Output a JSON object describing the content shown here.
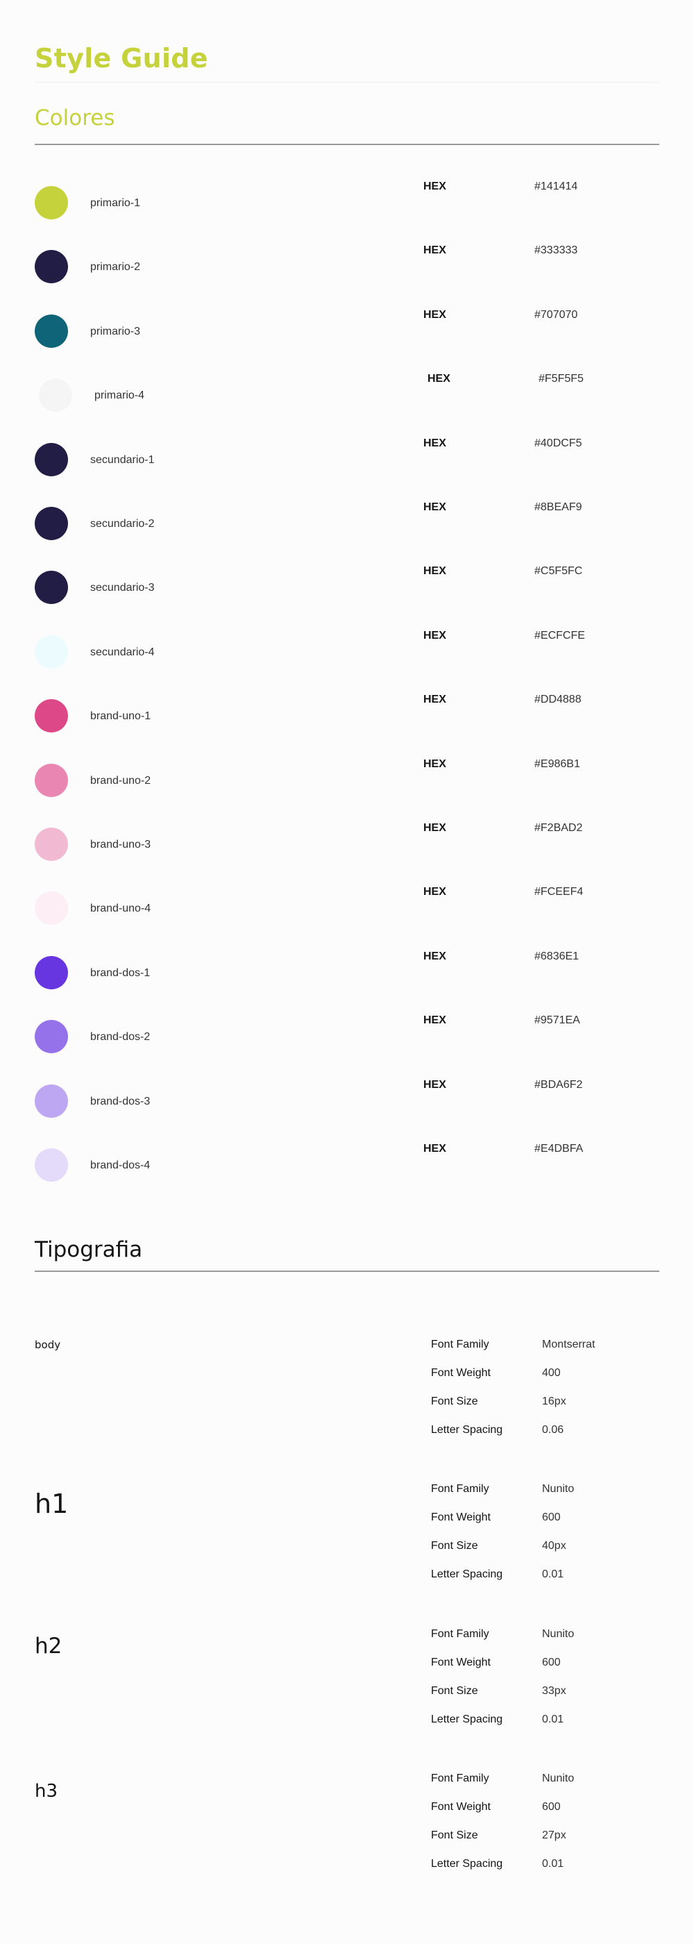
{
  "page": {
    "title": "Style Guide"
  },
  "colores": {
    "heading": "Colores",
    "hex_label": "HEX",
    "items": [
      {
        "name": "primario-1",
        "hex": "#141414",
        "swatch": "#c6d23b"
      },
      {
        "name": "primario-2",
        "hex": "#333333",
        "swatch": "#221d45"
      },
      {
        "name": "primario-3",
        "hex": "#707070",
        "swatch": "#0f6577"
      },
      {
        "name": "primario-4",
        "hex": "#F5F5F5",
        "swatch": "#f5f5f5"
      },
      {
        "name": "secundario-1",
        "hex": "#40DCF5",
        "swatch": "#221d45"
      },
      {
        "name": "secundario-2",
        "hex": "#8BEAF9",
        "swatch": "#221d45"
      },
      {
        "name": "secundario-3",
        "hex": "#C5F5FC",
        "swatch": "#221d45"
      },
      {
        "name": "secundario-4",
        "hex": "#ECFCFE",
        "swatch": "#ecfcfe"
      },
      {
        "name": "brand-uno-1",
        "hex": "#DD4888",
        "swatch": "#dd4888"
      },
      {
        "name": "brand-uno-2",
        "hex": "#E986B1",
        "swatch": "#e986b1"
      },
      {
        "name": "brand-uno-3",
        "hex": "#F2BAD2",
        "swatch": "#f2bad2"
      },
      {
        "name": "brand-uno-4",
        "hex": "#FCEEF4",
        "swatch": "#fceef4"
      },
      {
        "name": "brand-dos-1",
        "hex": "#6836E1",
        "swatch": "#6836e1"
      },
      {
        "name": "brand-dos-2",
        "hex": "#9571EA",
        "swatch": "#9571ea"
      },
      {
        "name": "brand-dos-3",
        "hex": "#BDA6F2",
        "swatch": "#bda6f2"
      },
      {
        "name": "brand-dos-4",
        "hex": "#E4DBFA",
        "swatch": "#e4dbfa"
      }
    ]
  },
  "tipografia": {
    "heading": "Tipografia",
    "blocks": [
      {
        "sample": "body",
        "font_family": "Montserrat",
        "font_weight": "400",
        "font_size": "16px",
        "letter_spacing": "0.06"
      },
      {
        "sample": "h1",
        "font_family": "Nunito",
        "font_weight": "600",
        "font_size": "40px",
        "letter_spacing": "0.01"
      },
      {
        "sample": "h2",
        "font_family": "Nunito",
        "font_weight": "600",
        "font_size": "33px",
        "letter_spacing": "0.01"
      },
      {
        "sample": "h3",
        "font_family": "Nunito",
        "font_weight": "600",
        "font_size": "27px",
        "letter_spacing": "0.01"
      }
    ],
    "labels": {
      "font_family": "Font Family",
      "font_weight": "Font Weight",
      "font_size": "Font Size",
      "letter_spacing": "Letter Spacing"
    }
  }
}
